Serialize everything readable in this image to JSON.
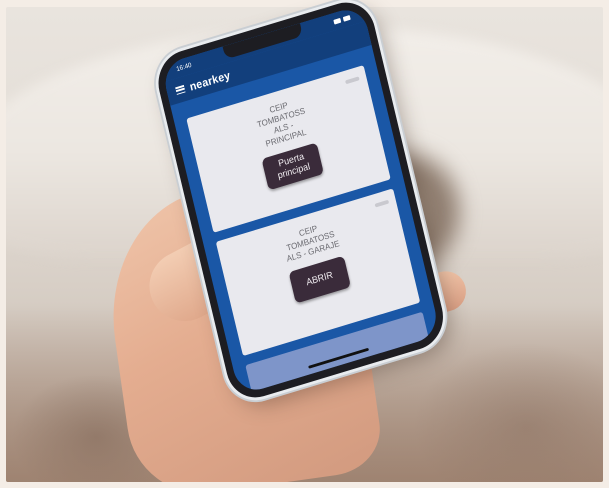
{
  "status_bar": {
    "time": "16:40"
  },
  "app": {
    "brand": "nearkey"
  },
  "doors": [
    {
      "title": "CEIP TOMBATOSS ALS - PRINCIPAL",
      "button_label": "Puerta principal"
    },
    {
      "title": "CEIP TOMBATOSS ALS - GARAJE",
      "button_label": "ABRIR"
    }
  ],
  "colors": {
    "app_blue": "#1a57a6",
    "header_blue": "#123f7c",
    "card_bg": "#e9e9ee",
    "button_bg": "#3a2b3a"
  },
  "icons": [
    "menu-icon",
    "signal-icon",
    "battery-icon"
  ]
}
